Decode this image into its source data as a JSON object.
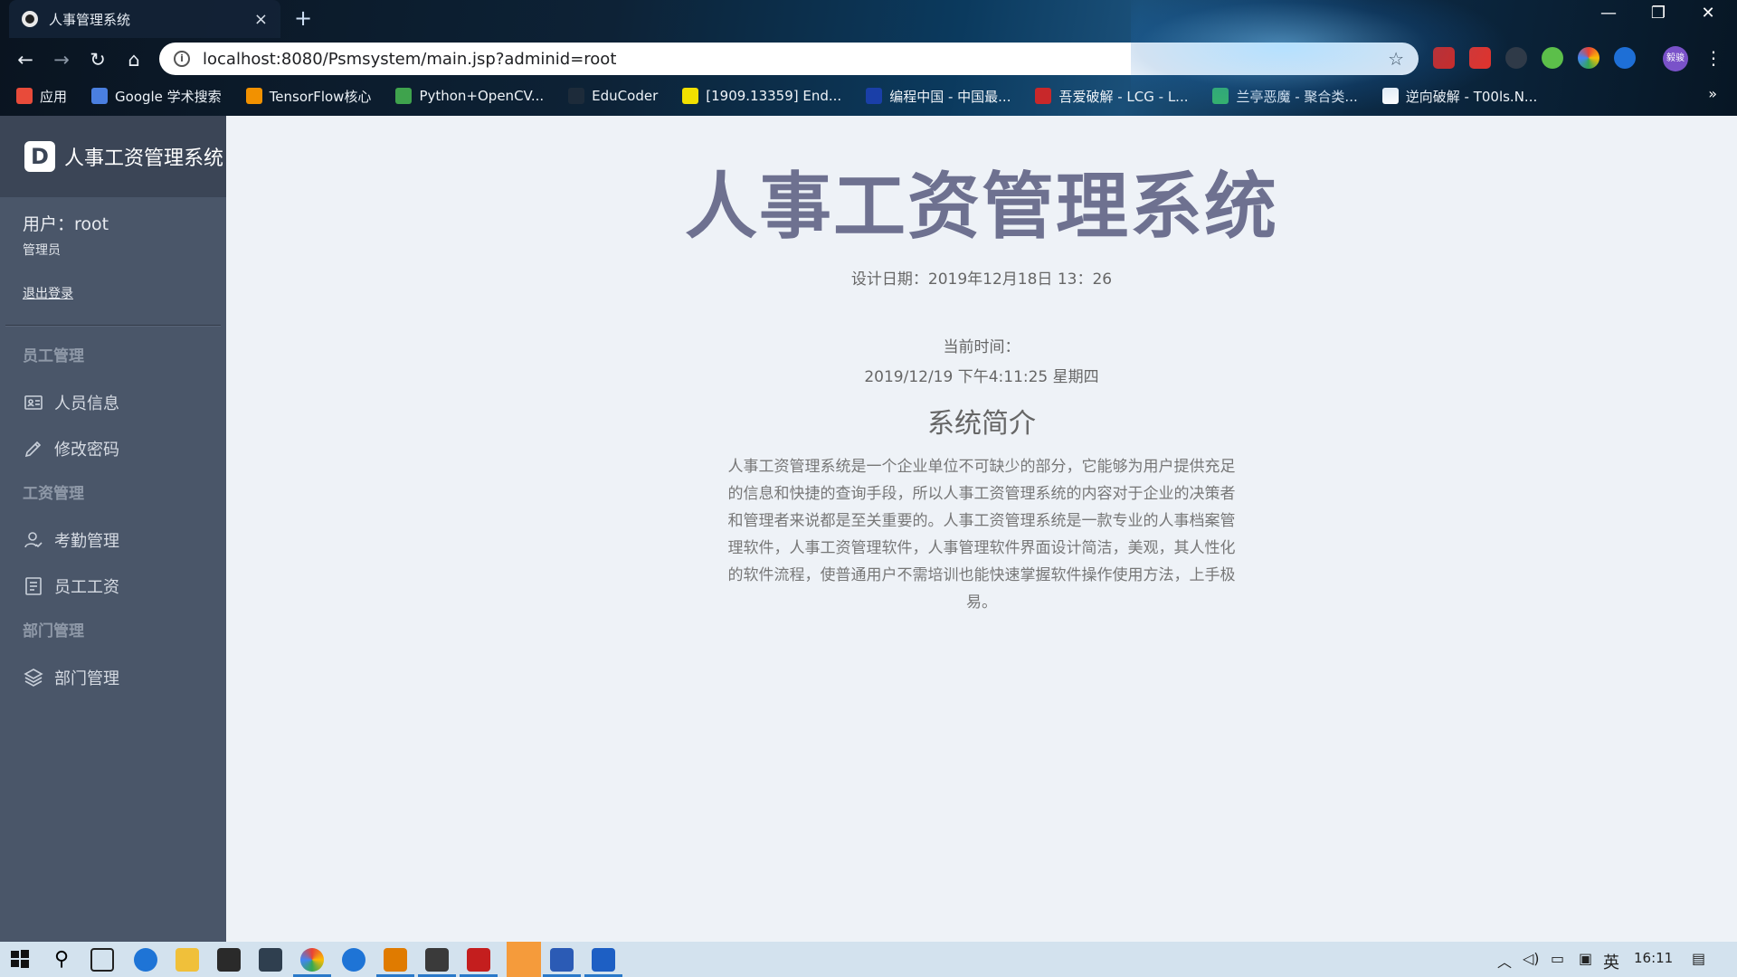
{
  "browser": {
    "tab_title": "人事管理系统",
    "tab_close": "×",
    "new_tab": "+",
    "url": "localhost:8080/Psmsystem/main.jsp?adminid=root",
    "avatar_text": "毅骏",
    "bookmarks": [
      {
        "label": "应用",
        "color": "#e84b3a"
      },
      {
        "label": "Google 学术搜索",
        "color": "#4a7fe0"
      },
      {
        "label": "TensorFlow核心",
        "color": "#f29100"
      },
      {
        "label": "Python+OpenCV...",
        "color": "#3fa34d"
      },
      {
        "label": "EduCoder",
        "color": "#1d2b3a"
      },
      {
        "label": "[1909.13359] End...",
        "color": "#f2e000"
      },
      {
        "label": "编程中国 - 中国最...",
        "color": "#1a3fa8"
      },
      {
        "label": "吾爱破解 - LCG - L...",
        "color": "#c8282a"
      },
      {
        "label": "兰亭恶魔 - 聚合类...",
        "color": "#36b56a"
      },
      {
        "label": "逆向破解 - T00ls.N...",
        "color": "#ffffff"
      }
    ],
    "bookmarks_more": "»"
  },
  "sidebar": {
    "brand_logo": "D",
    "brand_title": "人事工资管理系统",
    "user_name": "用户：root",
    "user_role": "管理员",
    "logout": "退出登录",
    "groups": [
      {
        "title": "员工管理",
        "items": [
          {
            "label": "人员信息",
            "icon": "id-card-icon"
          },
          {
            "label": "修改密码",
            "icon": "pencil-icon"
          }
        ]
      },
      {
        "title": "工资管理",
        "items": [
          {
            "label": "考勤管理",
            "icon": "user-check-icon"
          },
          {
            "label": "员工工资",
            "icon": "document-icon"
          }
        ]
      },
      {
        "title": "部门管理",
        "items": [
          {
            "label": "部门管理",
            "icon": "layers-icon"
          }
        ]
      }
    ]
  },
  "main": {
    "title": "人事工资管理系统",
    "design_date": "设计日期：2019年12月18日 13：26",
    "now_label": "当前时间：",
    "now_value": "2019/12/19 下午4:11:25 星期四",
    "intro_title": "系统简介",
    "intro_text": "人事工资管理系统是一个企业单位不可缺少的部分，它能够为用户提供充足的信息和快捷的查询手段，所以人事工资管理系统的内容对于企业的决策者和管理者来说都是至关重要的。人事工资管理系统是一款专业的人事档案管理软件，人事工资管理软件，人事管理软件界面设计简洁，美观，其人性化的软件流程，使普通用户不需培训也能快速掌握软件操作使用方法，上手极易。"
  },
  "taskbar": {
    "ime": "英",
    "clock": "16:11"
  }
}
